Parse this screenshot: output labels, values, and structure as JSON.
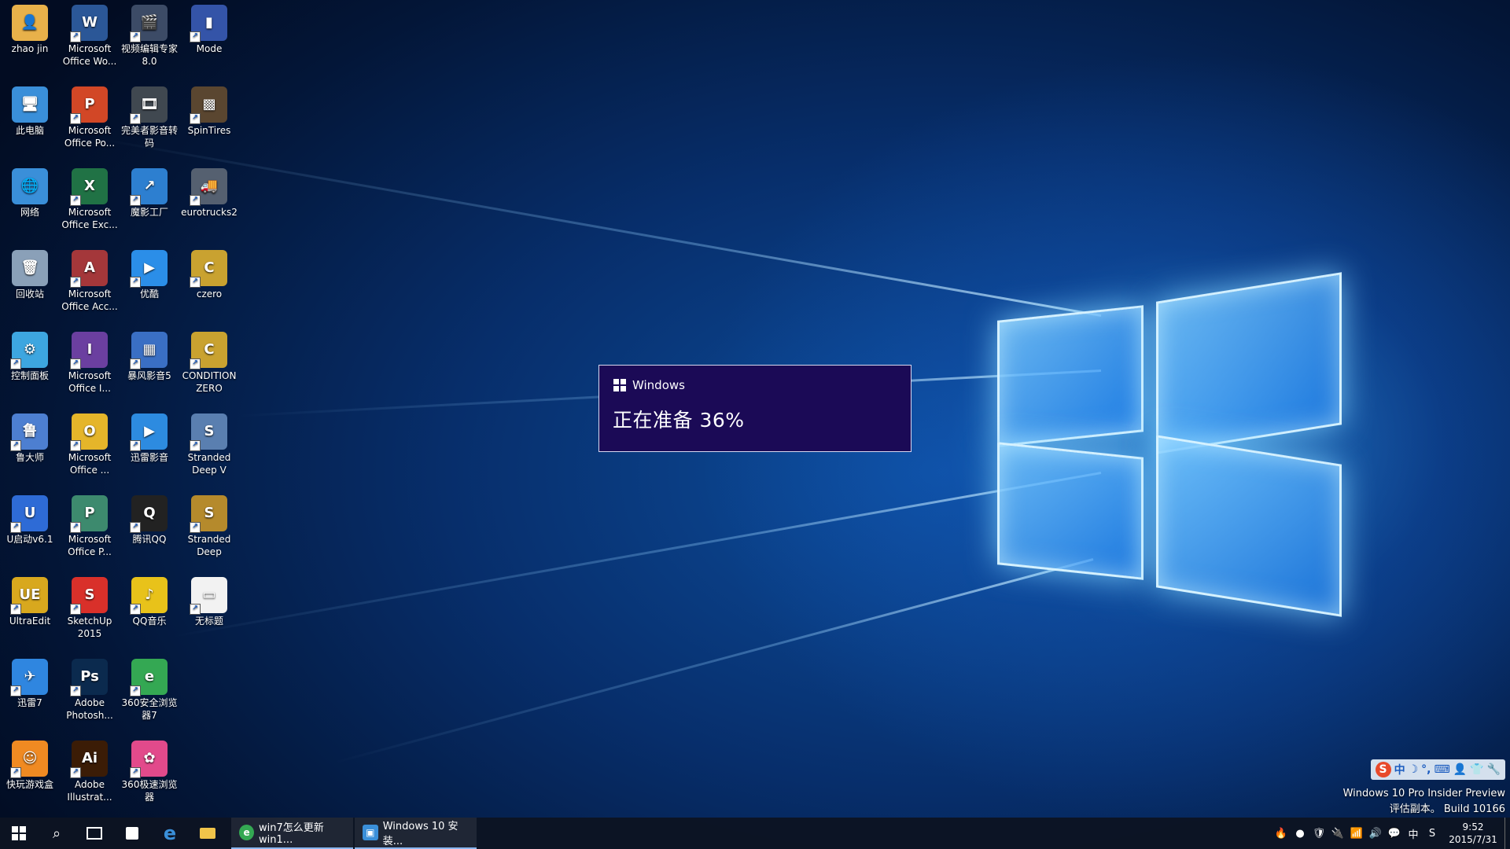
{
  "desktop": {
    "icons": [
      {
        "label": "zhao jin",
        "glyph": "👤",
        "color": "#e8b14a"
      },
      {
        "label": "此电脑",
        "glyph": "🖥",
        "color": "#3a8fd9"
      },
      {
        "label": "网络",
        "glyph": "🌐",
        "color": "#3a8fd9"
      },
      {
        "label": "回收站",
        "glyph": "🗑",
        "color": "#8aa0b8"
      },
      {
        "label": "控制面板",
        "glyph": "⚙",
        "color": "#3da6e0"
      },
      {
        "label": "鲁大师",
        "glyph": "鲁",
        "color": "#4d7fd1"
      },
      {
        "label": "U启动v6.1",
        "glyph": "U",
        "color": "#2e6bd6"
      },
      {
        "label": "UltraEdit",
        "glyph": "UE",
        "color": "#d8a81e"
      },
      {
        "label": "迅雷7",
        "glyph": "✈",
        "color": "#2f86e0"
      },
      {
        "label": "快玩游戏盒",
        "glyph": "☺",
        "color": "#f08a22"
      },
      {
        "label": "Microsoft Office Wo...",
        "glyph": "W",
        "color": "#2b5797"
      },
      {
        "label": "Microsoft Office Po...",
        "glyph": "P",
        "color": "#d24726"
      },
      {
        "label": "Microsoft Office Exc...",
        "glyph": "X",
        "color": "#207245"
      },
      {
        "label": "Microsoft Office Acc...",
        "glyph": "A",
        "color": "#a4373a"
      },
      {
        "label": "Microsoft Office I...",
        "glyph": "I",
        "color": "#6b3fa0"
      },
      {
        "label": "Microsoft Office ...",
        "glyph": "O",
        "color": "#e5b52a"
      },
      {
        "label": "Microsoft Office P...",
        "glyph": "P",
        "color": "#3d8a6e"
      },
      {
        "label": "SketchUp 2015",
        "glyph": "S",
        "color": "#d9302a"
      },
      {
        "label": "Adobe Photosh...",
        "glyph": "Ps",
        "color": "#0b2a4e"
      },
      {
        "label": "Adobe Illustrat...",
        "glyph": "Ai",
        "color": "#3b1c06"
      },
      {
        "label": "视频编辑专家 8.0",
        "glyph": "🎬",
        "color": "#3c4b66"
      },
      {
        "label": "完美者影音转码",
        "glyph": "🎞",
        "color": "#404850"
      },
      {
        "label": "魔影工厂",
        "glyph": "↗",
        "color": "#2d7fd0"
      },
      {
        "label": "优酷",
        "glyph": "▶",
        "color": "#2b8ee8"
      },
      {
        "label": "暴风影音5",
        "glyph": "▦",
        "color": "#3a6fc4"
      },
      {
        "label": "迅雷影音",
        "glyph": "▶",
        "color": "#2d8be0"
      },
      {
        "label": "腾讯QQ",
        "glyph": "Q",
        "color": "#222222"
      },
      {
        "label": "QQ音乐",
        "glyph": "♪",
        "color": "#e8c21a"
      },
      {
        "label": "360安全浏览器7",
        "glyph": "e",
        "color": "#34a853"
      },
      {
        "label": "360极速浏览器",
        "glyph": "✿",
        "color": "#e24a8b"
      },
      {
        "label": "Mode",
        "glyph": "▮",
        "color": "#3454a8"
      },
      {
        "label": "SpinTires",
        "glyph": "▩",
        "color": "#5a4630"
      },
      {
        "label": "eurotrucks2",
        "glyph": "🚚",
        "color": "#556070"
      },
      {
        "label": "czero",
        "glyph": "C",
        "color": "#c9a230"
      },
      {
        "label": "CONDITION ZERO",
        "glyph": "C",
        "color": "#c9a230"
      },
      {
        "label": "Stranded Deep V",
        "glyph": "S",
        "color": "#5a7fb0"
      },
      {
        "label": "Stranded Deep",
        "glyph": "S",
        "color": "#b58a2c"
      },
      {
        "label": "无标题",
        "glyph": "▭",
        "color": "#f2f2f2"
      }
    ]
  },
  "dialog": {
    "title": "Windows",
    "message": "正在准备 36%",
    "progress_percent": 36
  },
  "ime": {
    "logo": "S",
    "items": [
      "中",
      "☽",
      "°,",
      "⌨",
      "👤",
      "👕",
      "🔧"
    ]
  },
  "watermark": {
    "line1": "Windows 10 Pro Insider Preview",
    "line2": "评估副本。 Build 10166"
  },
  "taskbar": {
    "start_icon": "windows-logo",
    "search_icon": "search",
    "taskview_icon": "task-view",
    "pinned": [
      "store",
      "edge",
      "file-explorer"
    ],
    "apps": [
      {
        "label": "win7怎么更新win1...",
        "icon_color": "#34a853",
        "icon": "e"
      },
      {
        "label": "Windows 10 安装...",
        "icon_color": "#3a8fd9",
        "icon": "▣"
      }
    ],
    "tray": [
      "🔥",
      "●",
      "🛡",
      "🔌",
      "📶",
      "🔊",
      "💬",
      "中",
      "S"
    ],
    "time": "9:52",
    "date": "2015/7/31"
  },
  "colors": {
    "dialog_bg": "#1b0a56",
    "taskbar_bg": "#0c1422",
    "accent": "#3a8fd9"
  }
}
